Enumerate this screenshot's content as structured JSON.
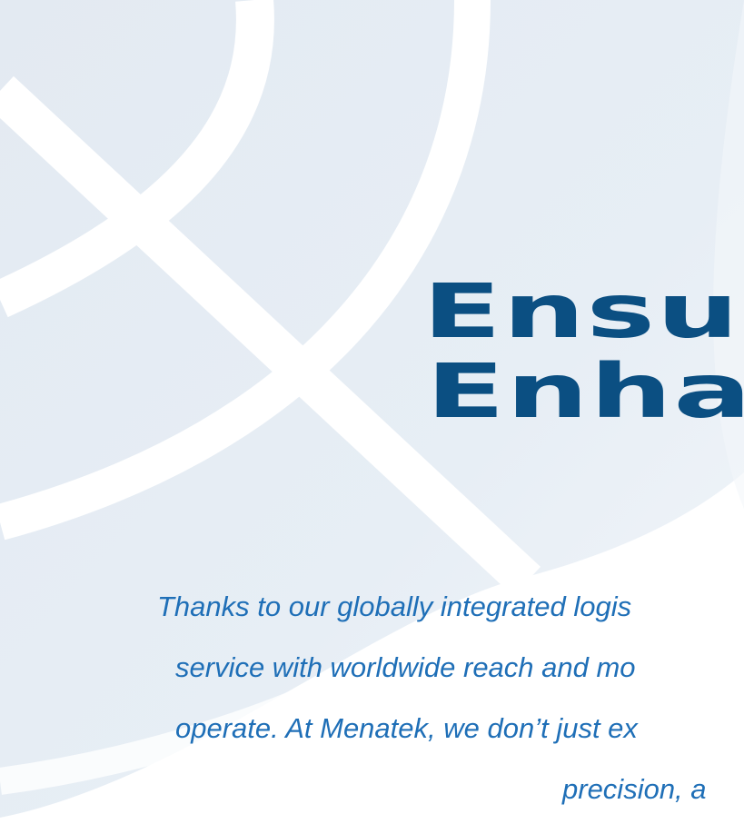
{
  "hero": {
    "headline_line1": "Ensur",
    "headline_line2": "Enha",
    "body_line1": "Thanks to our globally integrated logis",
    "body_line2": "service with worldwide reach and mo",
    "body_line3": "operate. At Menatek, we don’t just ex",
    "body_line4": "precision, a",
    "headline_color": "#0b4f82",
    "body_color": "#1f6fb7",
    "background_tint": "#e6edf4"
  }
}
